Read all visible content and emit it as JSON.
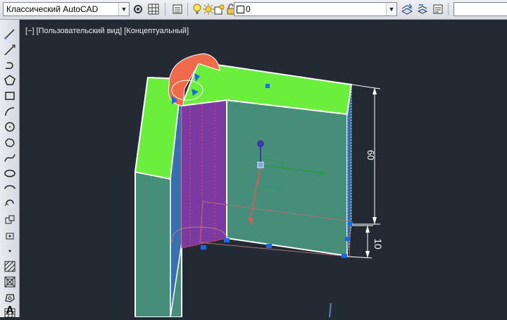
{
  "toolbar": {
    "workspace": "Классический AutoCAD",
    "layer_value": "0",
    "colors": {
      "bg_top": "#eef0f3",
      "bg_bottom": "#d9dde3"
    }
  },
  "viewport": {
    "control_minus": "[−]",
    "view_label": "[Пользовательский вид]",
    "style_label": "[Концептуальный]",
    "background": "#232a33"
  },
  "dimensions": {
    "vertical_value": "60",
    "small_value": "10"
  },
  "left_toolbar": {
    "icons": [
      "line-icon",
      "construction-line-icon",
      "polyline-icon",
      "polygon-icon",
      "rectangle-icon",
      "arc-icon",
      "circle-icon",
      "revision-cloud-icon",
      "spline-icon",
      "ellipse-icon",
      "ellipse-arc-icon",
      "insert-block-icon",
      "make-block-icon",
      "point-icon",
      "hatch-icon",
      "gradient-icon",
      "region-icon",
      "table-icon",
      "multiline-text-icon"
    ]
  }
}
